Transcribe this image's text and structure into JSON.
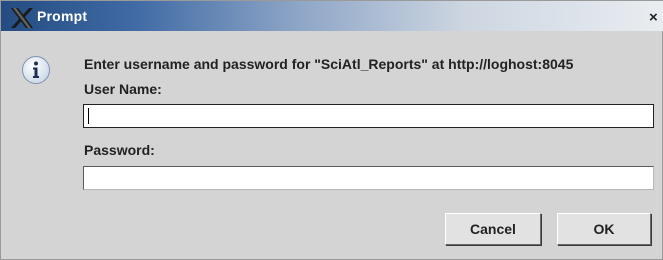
{
  "window": {
    "title": "Prompt",
    "close_glyph": "×"
  },
  "dialog": {
    "message": "Enter username and password for \"SciAtl_Reports\" at http://loghost:8045",
    "user_name_label": "User Name:",
    "user_name_value": "",
    "password_label": "Password:",
    "password_value": "",
    "cancel_label": "Cancel",
    "ok_label": "OK"
  },
  "icons": {
    "title": "x-logo-icon",
    "info": "info-icon",
    "close": "close-icon"
  },
  "colors": {
    "titlebar_start": "#244c82",
    "titlebar_end": "#e9edf1",
    "dialog_bg": "#d4d4d4",
    "info_icon_fill": "#e8f0f8",
    "info_icon_border": "#7f93ad"
  }
}
